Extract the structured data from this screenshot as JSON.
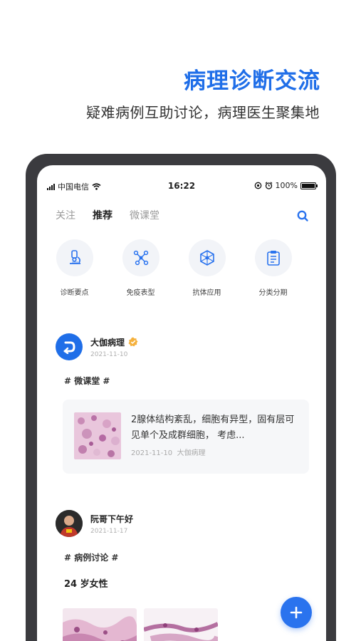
{
  "promo": {
    "headline": "病理诊断交流",
    "subline": "疑难病例互助讨论，病理医生聚集地"
  },
  "status_bar": {
    "carrier": "中国电信",
    "time": "16:22",
    "battery": "100%"
  },
  "tabs": [
    {
      "label": "关注",
      "active": false
    },
    {
      "label": "推荐",
      "active": true
    },
    {
      "label": "微课堂",
      "active": false
    }
  ],
  "categories": [
    {
      "label": "诊断要点",
      "icon": "microscope-icon"
    },
    {
      "label": "免疫表型",
      "icon": "molecule-icon"
    },
    {
      "label": "抗体应用",
      "icon": "hexagon-network-icon"
    },
    {
      "label": "分类分期",
      "icon": "clipboard-icon"
    }
  ],
  "posts": [
    {
      "author": "大伽病理",
      "date": "2021-11-10",
      "verified": true,
      "topic": "# 微课堂 #",
      "card": {
        "text": "2腺体结构紊乱，细胞有异型，固有层可见单个及成群细胞， 考虑...",
        "date": "2021-11-10",
        "author": "大伽病理"
      }
    },
    {
      "author": "阮哥下午好",
      "date": "2021-11-17",
      "topic": "# 病例讨论 #",
      "title": "24 岁女性"
    }
  ],
  "colors": {
    "accent": "#2a73ee",
    "headline": "#1f6ee8",
    "device_frame": "#3b3b3f"
  }
}
